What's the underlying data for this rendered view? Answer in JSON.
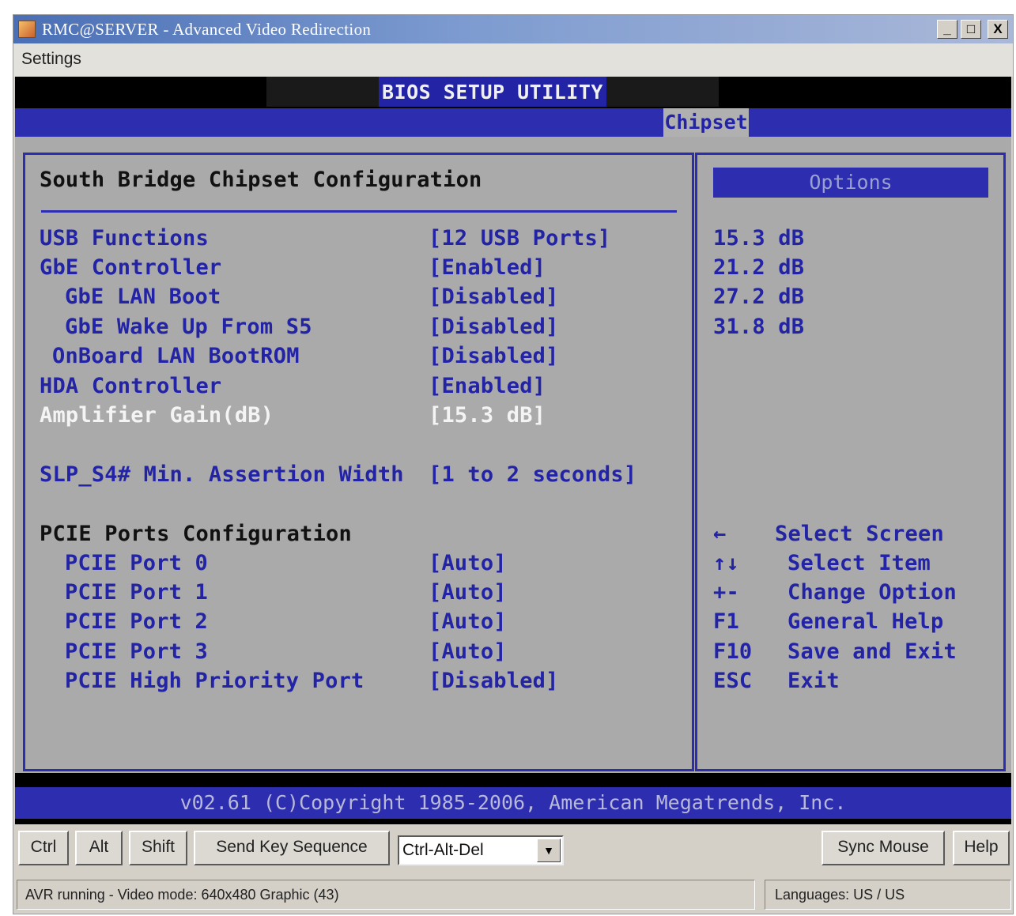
{
  "window": {
    "title": "RMC@SERVER - Advanced Video Redirection",
    "icon": "app-icon",
    "minimize": "_",
    "maximize": "□",
    "close": "X"
  },
  "menu": {
    "settings": "Settings"
  },
  "bios": {
    "title": "BIOS SETUP UTILITY",
    "active_tab": "Chipset",
    "section_title": "South Bridge Chipset Configuration",
    "items": [
      {
        "label": "USB Functions",
        "value": "[12 USB Ports]"
      },
      {
        "label": "GbE Controller",
        "value": "[Enabled]"
      },
      {
        "label": "GbE LAN Boot",
        "value": "[Disabled]"
      },
      {
        "label": "GbE Wake Up From S5",
        "value": "[Disabled]"
      },
      {
        "label": "OnBoard LAN BootROM",
        "value": "[Disabled]"
      },
      {
        "label": "HDA Controller",
        "value": "[Enabled]"
      },
      {
        "label": "Amplifier Gain(dB)",
        "value": "[15.3 dB]"
      },
      {
        "label": "SLP_S4# Min. Assertion Width",
        "value": "[1 to 2 seconds]"
      }
    ],
    "pcie_title": "PCIE Ports Configuration",
    "pcie_items": [
      {
        "label": "PCIE Port 0",
        "value": "[Auto]"
      },
      {
        "label": "PCIE Port 1",
        "value": "[Auto]"
      },
      {
        "label": "PCIE Port 2",
        "value": "[Auto]"
      },
      {
        "label": "PCIE Port 3",
        "value": "[Auto]"
      },
      {
        "label": "PCIE High Priority Port",
        "value": "[Disabled]"
      }
    ],
    "options_title": "Options",
    "options": [
      "15.3 dB",
      "21.2 dB",
      "27.2 dB",
      "31.8 dB"
    ],
    "help": [
      {
        "key": "←",
        "action": "Select Screen"
      },
      {
        "key": "↑↓",
        "action": "Select Item"
      },
      {
        "key": "+-",
        "action": "Change Option"
      },
      {
        "key": "F1",
        "action": "General Help"
      },
      {
        "key": "F10",
        "action": "Save and Exit"
      },
      {
        "key": "ESC",
        "action": "Exit"
      }
    ],
    "footer": "v02.61 (C)Copyright 1985-2006, American Megatrends, Inc."
  },
  "toolbar": {
    "ctrl": "Ctrl",
    "alt": "Alt",
    "shift": "Shift",
    "send_key_sequence": "Send Key Sequence",
    "key_sequence_value": "Ctrl-Alt-Del",
    "sync_mouse": "Sync Mouse",
    "help": "Help"
  },
  "status": {
    "left": "AVR running - Video mode: 640x480 Graphic (43)",
    "right": "Languages: US / US"
  }
}
